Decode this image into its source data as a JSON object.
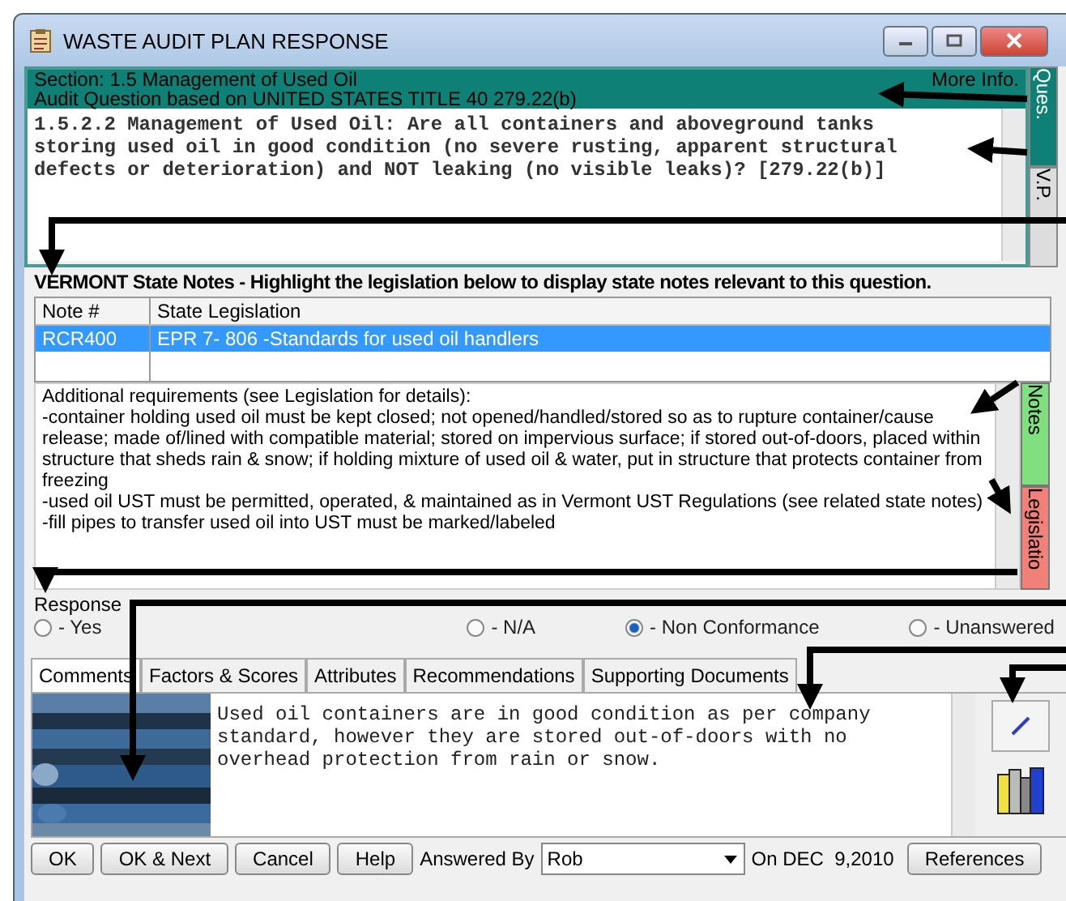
{
  "window": {
    "title": "WASTE AUDIT PLAN RESPONSE"
  },
  "header": {
    "section": "Section: 1.5 Management of Used Oil",
    "basis": "Audit Question based on UNITED STATES TITLE 40 279.22(b)",
    "more_info": "More Info."
  },
  "question": "1.5.2.2 Management of Used Oil: Are all containers and aboveground tanks storing used oil in good condition (no severe rusting, apparent structural defects or deterioration) and NOT leaking (no visible leaks)? [279.22(b)]",
  "side_tabs": [
    {
      "label": "Ques.",
      "selected": true
    },
    {
      "label": "V.P.",
      "selected": false
    }
  ],
  "state_notes": {
    "heading": "VERMONT State Notes - Highlight the legislation below to display state notes relevant to this question.",
    "columns": [
      "Note #",
      "State Legislation"
    ],
    "rows": [
      {
        "note": "RCR400",
        "legislation": "EPR 7- 806 -Standards for used oil handlers",
        "selected": true
      }
    ],
    "text": [
      "Additional requirements (see Legislation for details):",
      "-container holding used oil must be kept closed; not opened/handled/stored so as to rupture container/cause release; made of/lined with compatible material; stored on impervious surface; if stored out-of-doors, placed within structure that sheds rain & snow; if holding mixture of used oil & water, put in structure that protects container from freezing",
      "-used oil UST must be permitted, operated, & maintained as in Vermont UST Regulations (see related state notes)",
      "-fill pipes to transfer used oil into UST must be marked/labeled"
    ]
  },
  "note_tabs": [
    {
      "label": "Notes",
      "color": "#80e080"
    },
    {
      "label": "Legislatio",
      "color": "#f08078"
    }
  ],
  "response": {
    "label": "Response",
    "options": [
      {
        "label": "- Yes",
        "selected": false
      },
      {
        "label": "- N/A",
        "selected": false
      },
      {
        "label": "- Non Conformance",
        "selected": true
      },
      {
        "label": "- Unanswered",
        "selected": false
      }
    ]
  },
  "tabs": [
    {
      "label": "Comments",
      "selected": true
    },
    {
      "label": "Factors & Scores",
      "selected": false
    },
    {
      "label": "Attributes",
      "selected": false
    },
    {
      "label": "Recommendations",
      "selected": false
    },
    {
      "label": "Supporting Documents",
      "selected": false
    }
  ],
  "comment": "Used oil containers are in good condition as per company standard, however they are stored out-of-doors with no overhead protection from rain or snow.",
  "buttons": [
    "OK",
    "OK & Next",
    "Cancel",
    "Help"
  ],
  "answered_by": {
    "label": "Answered By",
    "value": "Rob"
  },
  "date": "On DEC  9,2010",
  "references_button": "References"
}
